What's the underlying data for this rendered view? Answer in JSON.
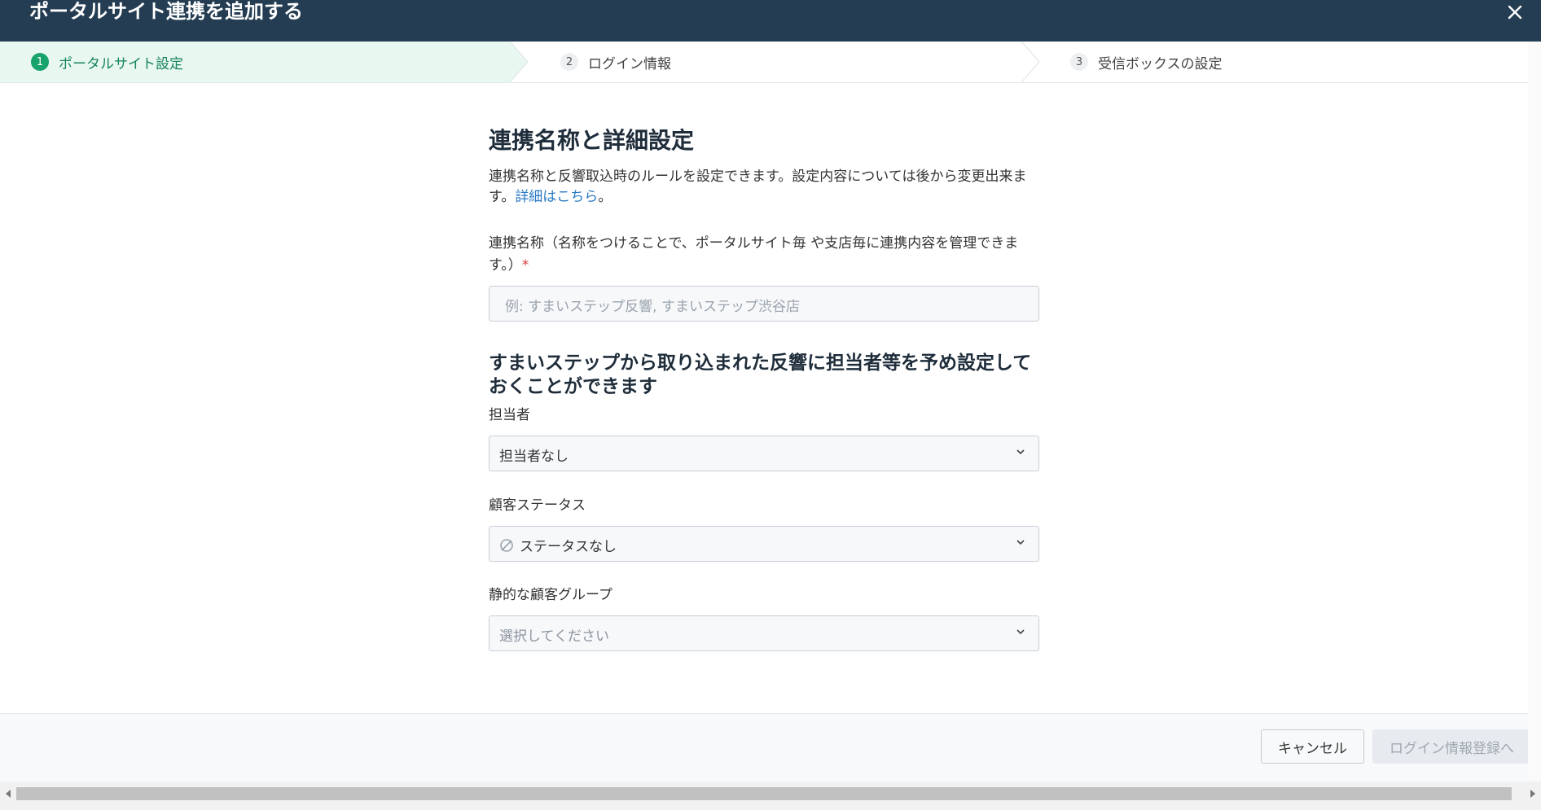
{
  "header": {
    "title": "ポータルサイト連携を追加する",
    "close_icon": "close-icon"
  },
  "stepper": {
    "steps": [
      {
        "num": "1",
        "label": "ポータルサイト設定",
        "state": "active"
      },
      {
        "num": "2",
        "label": "ログイン情報",
        "state": "inactive"
      },
      {
        "num": "3",
        "label": "受信ボックスの設定",
        "state": "inactive"
      }
    ]
  },
  "main": {
    "title": "連携名称と詳細設定",
    "description": "連携名称と反響取込時のルールを設定できます。設定内容については後から変更出来ます。",
    "details_link": "詳細はこちら",
    "description_end": "。",
    "name_field": {
      "label": "連携名称（名称をつけることで、ポータルサイト毎 や支店毎に連携内容を管理できます。）",
      "required_mark": "*",
      "placeholder": "例: すまいステップ反響, すまいステップ渋谷店"
    },
    "defaults_title": "すまいステップから取り込まれた反響に担当者等を予め設定しておくことができます",
    "assignee": {
      "label": "担当者",
      "value": "担当者なし"
    },
    "customer_status": {
      "label": "顧客ステータス",
      "value": "ステータスなし",
      "icon": "no-status-icon"
    },
    "static_group": {
      "label": "静的な顧客グループ",
      "placeholder": "選択してください"
    }
  },
  "footer": {
    "cancel_label": "キャンセル",
    "next_label": "ログイン情報登録へ"
  },
  "colors": {
    "header_bg": "#243d52",
    "active_step_bg": "#e8f8f0",
    "active_step": "#17a36b",
    "link": "#2979c4",
    "required": "#d83a3a"
  }
}
